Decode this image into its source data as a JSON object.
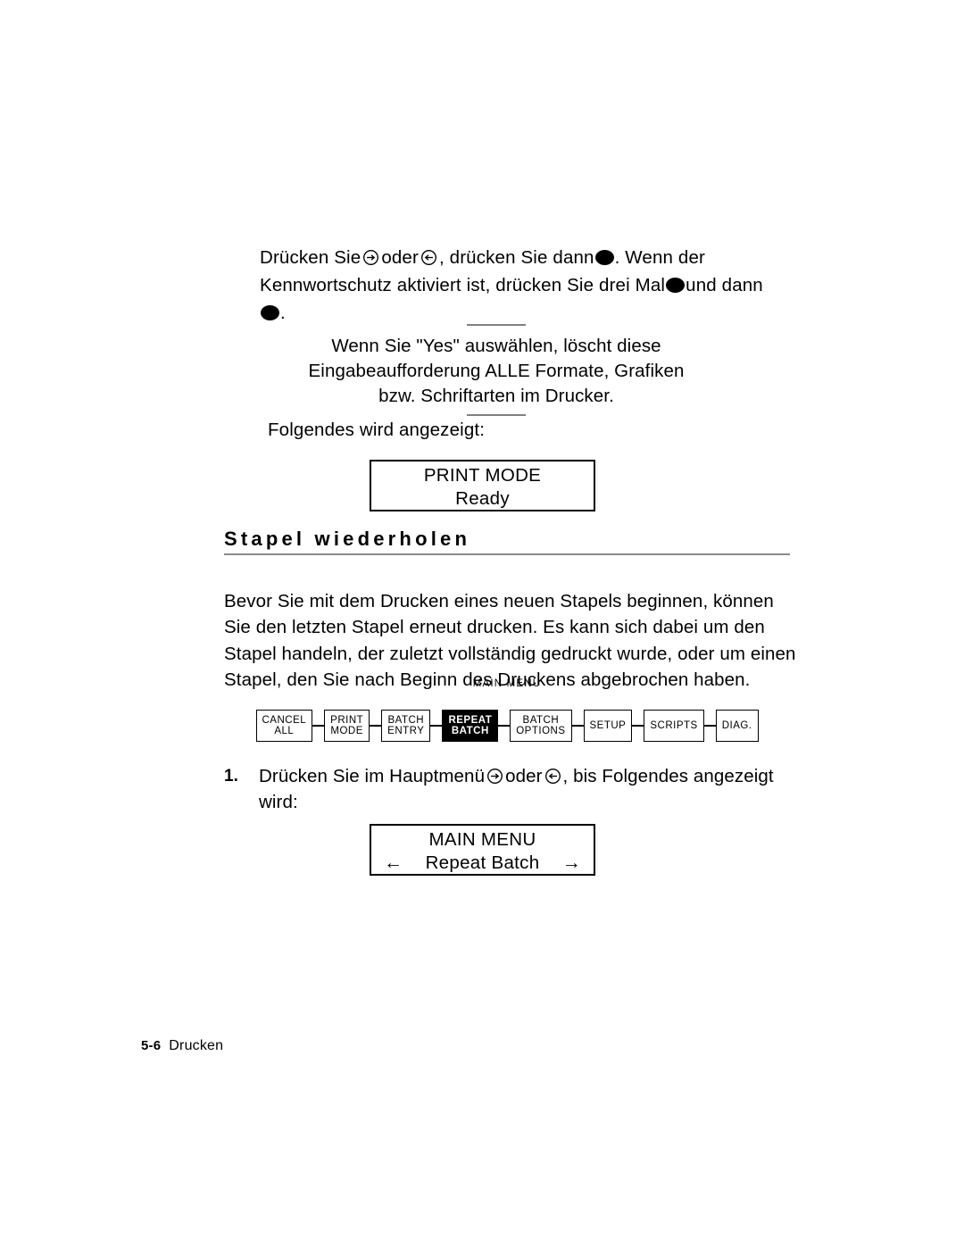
{
  "intro": {
    "part1": "Drücken Sie",
    "part2": "oder",
    "part3": ", drücken Sie dann",
    "part4": ". Wenn der Kennwortschutz aktiviert ist, drücken Sie drei Mal",
    "part5": "und dann",
    "part6": "."
  },
  "note": {
    "line1": "Wenn Sie \"Yes\" auswählen, löscht diese",
    "line2": "Eingabeaufforderung ALLE Formate, Grafiken",
    "line3": "bzw. Schriftarten im Drucker."
  },
  "lead_in": "Folgendes wird angezeigt:",
  "display_print_mode": {
    "line1": "PRINT MODE",
    "line2": "Ready"
  },
  "section": {
    "heading": "Stapel wiederholen",
    "paragraph": "Bevor Sie mit dem Drucken eines neuen Stapels beginnen, können Sie den letzten Stapel erneut drucken. Es kann sich dabei um den Stapel handeln, der zuletzt vollständig gedruckt wurde, oder um einen Stapel, den Sie nach Beginn des Druckens abgebrochen haben."
  },
  "diagram": {
    "caption": "MAIN MENU",
    "items": [
      {
        "line1": "CANCEL",
        "line2": "ALL",
        "selected": false
      },
      {
        "line1": "PRINT",
        "line2": "MODE",
        "selected": false
      },
      {
        "line1": "BATCH",
        "line2": "ENTRY",
        "selected": false
      },
      {
        "line1": "REPEAT",
        "line2": "BATCH",
        "selected": true
      },
      {
        "line1": "BATCH",
        "line2": "OPTIONS",
        "selected": false
      },
      {
        "line1": "SETUP",
        "line2": "",
        "selected": false
      },
      {
        "line1": "SCRIPTS",
        "line2": "",
        "selected": false
      },
      {
        "line1": "DIAG.",
        "line2": "",
        "selected": false
      }
    ]
  },
  "step1": {
    "number": "1.",
    "part1": "Drücken Sie im Hauptmenü",
    "part2": "oder",
    "part3": ", bis Folgendes angezeigt wird:"
  },
  "display_main_menu": {
    "title": "MAIN MENU",
    "value": "Repeat Batch",
    "arrow_left": "←",
    "arrow_right": "→"
  },
  "footer": {
    "page": "5-6",
    "chapter": "Drucken"
  },
  "colors": {
    "text": "#000000",
    "rule": "#808080",
    "heading_rule": "#8c8c8c",
    "selected_bg": "#000000",
    "selected_fg": "#ffffff"
  }
}
